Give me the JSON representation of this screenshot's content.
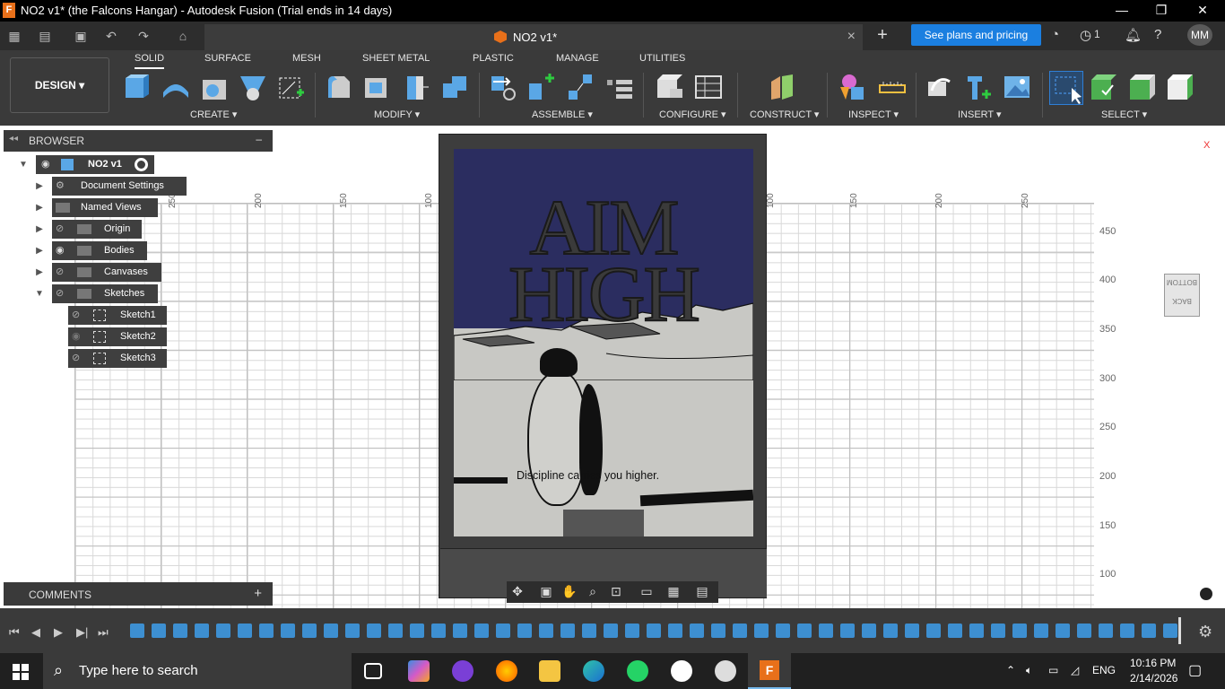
{
  "window": {
    "title": "NO2 v1* (the Falcons Hangar) - Autodesk Fusion (Trial ends in 14 days)",
    "app_icon": "F",
    "minimize": "—",
    "restore": "❐",
    "close": "✕"
  },
  "tabbar": {
    "doc_tab_name": "NO2 v1*",
    "close_tab": "×",
    "new_tab": "+",
    "plans_button": "See plans and pricing",
    "jobs_count": "1",
    "user_initials": "MM"
  },
  "ribbon": {
    "workspace": "DESIGN ▾",
    "tabs": [
      "SOLID",
      "SURFACE",
      "MESH",
      "SHEET METAL",
      "PLASTIC",
      "MANAGE",
      "UTILITIES"
    ],
    "groups": [
      "CREATE ▾",
      "MODIFY ▾",
      "ASSEMBLE ▾",
      "CONFIGURE ▾",
      "CONSTRUCT ▾",
      "INSPECT ▾",
      "INSERT ▾",
      "SELECT ▾"
    ]
  },
  "browser": {
    "title": "BROWSER",
    "collapse": "–",
    "root": "NO2 v1",
    "items": [
      {
        "label": "Document Settings"
      },
      {
        "label": "Named Views"
      },
      {
        "label": "Origin"
      },
      {
        "label": "Bodies"
      },
      {
        "label": "Canvases"
      },
      {
        "label": "Sketches"
      }
    ],
    "sketches": [
      "Sketch1",
      "Sketch2",
      "Sketch3"
    ]
  },
  "comments": {
    "title": "COMMENTS",
    "add": "+"
  },
  "viewport": {
    "x_ticks": [
      "250",
      "200",
      "150",
      "100",
      "100",
      "150",
      "200",
      "250"
    ],
    "y_ticks": [
      "450",
      "400",
      "350",
      "300",
      "250",
      "200",
      "150",
      "100"
    ],
    "viewcube_top": "BOTTOM",
    "viewcube_front": "BACK",
    "viewcube_x": "X"
  },
  "poster": {
    "title_line1": "AIM",
    "title_line2": "HIGH",
    "slogan": "Discipline carries you higher."
  },
  "taskbar": {
    "search_placeholder": "Type here to search",
    "language": "ENG",
    "time": "10:16 PM",
    "date": "2/14/2026"
  }
}
